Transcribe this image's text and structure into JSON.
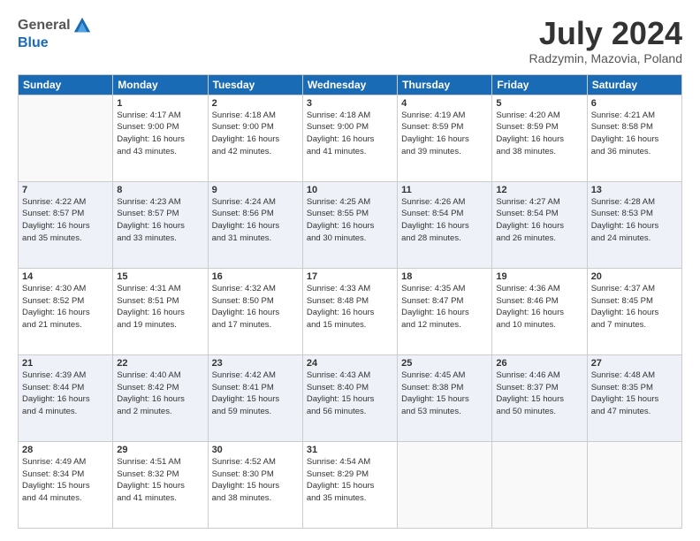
{
  "header": {
    "logo_general": "General",
    "logo_blue": "Blue",
    "month_title": "July 2024",
    "location": "Radzymin, Mazovia, Poland"
  },
  "days_of_week": [
    "Sunday",
    "Monday",
    "Tuesday",
    "Wednesday",
    "Thursday",
    "Friday",
    "Saturday"
  ],
  "weeks": [
    [
      {
        "day": "",
        "info": ""
      },
      {
        "day": "1",
        "info": "Sunrise: 4:17 AM\nSunset: 9:00 PM\nDaylight: 16 hours\nand 43 minutes."
      },
      {
        "day": "2",
        "info": "Sunrise: 4:18 AM\nSunset: 9:00 PM\nDaylight: 16 hours\nand 42 minutes."
      },
      {
        "day": "3",
        "info": "Sunrise: 4:18 AM\nSunset: 9:00 PM\nDaylight: 16 hours\nand 41 minutes."
      },
      {
        "day": "4",
        "info": "Sunrise: 4:19 AM\nSunset: 8:59 PM\nDaylight: 16 hours\nand 39 minutes."
      },
      {
        "day": "5",
        "info": "Sunrise: 4:20 AM\nSunset: 8:59 PM\nDaylight: 16 hours\nand 38 minutes."
      },
      {
        "day": "6",
        "info": "Sunrise: 4:21 AM\nSunset: 8:58 PM\nDaylight: 16 hours\nand 36 minutes."
      }
    ],
    [
      {
        "day": "7",
        "info": "Sunrise: 4:22 AM\nSunset: 8:57 PM\nDaylight: 16 hours\nand 35 minutes."
      },
      {
        "day": "8",
        "info": "Sunrise: 4:23 AM\nSunset: 8:57 PM\nDaylight: 16 hours\nand 33 minutes."
      },
      {
        "day": "9",
        "info": "Sunrise: 4:24 AM\nSunset: 8:56 PM\nDaylight: 16 hours\nand 31 minutes."
      },
      {
        "day": "10",
        "info": "Sunrise: 4:25 AM\nSunset: 8:55 PM\nDaylight: 16 hours\nand 30 minutes."
      },
      {
        "day": "11",
        "info": "Sunrise: 4:26 AM\nSunset: 8:54 PM\nDaylight: 16 hours\nand 28 minutes."
      },
      {
        "day": "12",
        "info": "Sunrise: 4:27 AM\nSunset: 8:54 PM\nDaylight: 16 hours\nand 26 minutes."
      },
      {
        "day": "13",
        "info": "Sunrise: 4:28 AM\nSunset: 8:53 PM\nDaylight: 16 hours\nand 24 minutes."
      }
    ],
    [
      {
        "day": "14",
        "info": "Sunrise: 4:30 AM\nSunset: 8:52 PM\nDaylight: 16 hours\nand 21 minutes."
      },
      {
        "day": "15",
        "info": "Sunrise: 4:31 AM\nSunset: 8:51 PM\nDaylight: 16 hours\nand 19 minutes."
      },
      {
        "day": "16",
        "info": "Sunrise: 4:32 AM\nSunset: 8:50 PM\nDaylight: 16 hours\nand 17 minutes."
      },
      {
        "day": "17",
        "info": "Sunrise: 4:33 AM\nSunset: 8:48 PM\nDaylight: 16 hours\nand 15 minutes."
      },
      {
        "day": "18",
        "info": "Sunrise: 4:35 AM\nSunset: 8:47 PM\nDaylight: 16 hours\nand 12 minutes."
      },
      {
        "day": "19",
        "info": "Sunrise: 4:36 AM\nSunset: 8:46 PM\nDaylight: 16 hours\nand 10 minutes."
      },
      {
        "day": "20",
        "info": "Sunrise: 4:37 AM\nSunset: 8:45 PM\nDaylight: 16 hours\nand 7 minutes."
      }
    ],
    [
      {
        "day": "21",
        "info": "Sunrise: 4:39 AM\nSunset: 8:44 PM\nDaylight: 16 hours\nand 4 minutes."
      },
      {
        "day": "22",
        "info": "Sunrise: 4:40 AM\nSunset: 8:42 PM\nDaylight: 16 hours\nand 2 minutes."
      },
      {
        "day": "23",
        "info": "Sunrise: 4:42 AM\nSunset: 8:41 PM\nDaylight: 15 hours\nand 59 minutes."
      },
      {
        "day": "24",
        "info": "Sunrise: 4:43 AM\nSunset: 8:40 PM\nDaylight: 15 hours\nand 56 minutes."
      },
      {
        "day": "25",
        "info": "Sunrise: 4:45 AM\nSunset: 8:38 PM\nDaylight: 15 hours\nand 53 minutes."
      },
      {
        "day": "26",
        "info": "Sunrise: 4:46 AM\nSunset: 8:37 PM\nDaylight: 15 hours\nand 50 minutes."
      },
      {
        "day": "27",
        "info": "Sunrise: 4:48 AM\nSunset: 8:35 PM\nDaylight: 15 hours\nand 47 minutes."
      }
    ],
    [
      {
        "day": "28",
        "info": "Sunrise: 4:49 AM\nSunset: 8:34 PM\nDaylight: 15 hours\nand 44 minutes."
      },
      {
        "day": "29",
        "info": "Sunrise: 4:51 AM\nSunset: 8:32 PM\nDaylight: 15 hours\nand 41 minutes."
      },
      {
        "day": "30",
        "info": "Sunrise: 4:52 AM\nSunset: 8:30 PM\nDaylight: 15 hours\nand 38 minutes."
      },
      {
        "day": "31",
        "info": "Sunrise: 4:54 AM\nSunset: 8:29 PM\nDaylight: 15 hours\nand 35 minutes."
      },
      {
        "day": "",
        "info": ""
      },
      {
        "day": "",
        "info": ""
      },
      {
        "day": "",
        "info": ""
      }
    ]
  ]
}
